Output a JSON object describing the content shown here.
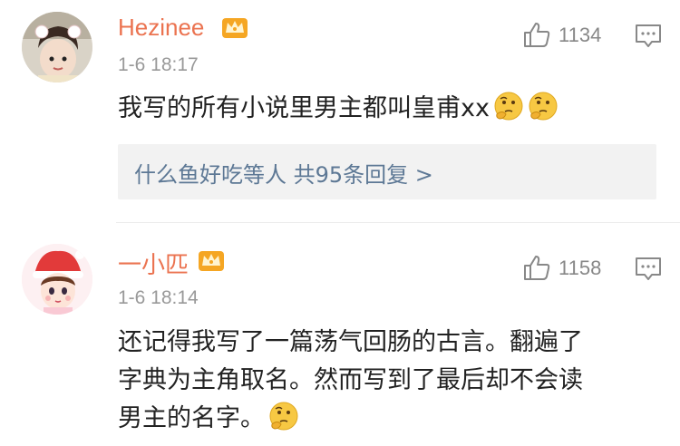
{
  "comments": [
    {
      "username": "Hezinee",
      "time": "1-6 18:17",
      "likes": "1134",
      "text": "我写的所有小说里男主都叫皇甫xx",
      "reply_summary": "什么鱼好吃等人  共95条回复 >"
    },
    {
      "username": "一小匹",
      "time": "1-6 18:14",
      "likes": "1158",
      "text_lines": [
        "还记得我写了一篇荡气回肠的古言。翻遍了",
        "字典为主角取名。然而写到了最后却不会读",
        "男主的名字。"
      ]
    }
  ],
  "icons": {
    "vip_crown": "crown-badge-icon",
    "like": "thumbs-up-icon",
    "reply": "comment-bubble-icon",
    "emoji": "thinking-face-emoji"
  },
  "colors": {
    "username": "#eb7350",
    "meta": "#999999",
    "link": "#5d7895",
    "reply_bg": "#f2f2f2",
    "emoji": "#f7c843"
  }
}
